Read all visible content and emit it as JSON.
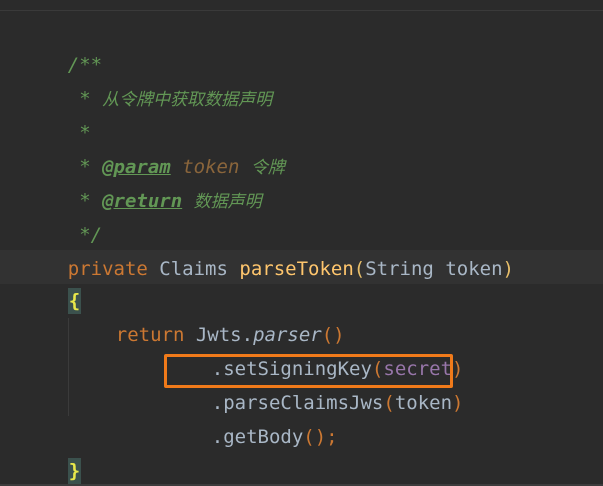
{
  "javadoc": {
    "open": "/**",
    "summary_prefix": " * ",
    "summary": "从令牌中获取数据声明",
    "empty": " *",
    "param_prefix": " * ",
    "param_tag": "@param",
    "param_name": "token",
    "param_desc": "令牌",
    "return_prefix": " * ",
    "return_tag": "@return",
    "return_desc": "数据声明",
    "close": " */"
  },
  "signature": {
    "modifier": "private",
    "return_type": "Claims",
    "method": "parseToken",
    "open_paren": "(",
    "param_type": "String",
    "param_name": "token",
    "close_paren": ")"
  },
  "body": {
    "open_brace": "{",
    "return_kw": "return",
    "receiver": "Jwts",
    "dot": ".",
    "parser_call": "parser",
    "parser_parens": "()",
    "call1_prefix": ".setSigningKey",
    "call1_open": "(",
    "call1_arg": "secret",
    "call1_close": ")",
    "call2_prefix": ".parseClaimsJws",
    "call2_open": "(",
    "call2_arg": "token",
    "call2_close": ")",
    "call3_prefix": ".getBody",
    "call3_parens": "()",
    "call3_semi": ";",
    "close_brace": "}"
  },
  "colors": {
    "background": "#2b2b2b",
    "comment": "#629755",
    "keyword": "#cc7832",
    "method": "#ffc66d",
    "field": "#9876aa",
    "highlight_box": "#f07a1a"
  }
}
